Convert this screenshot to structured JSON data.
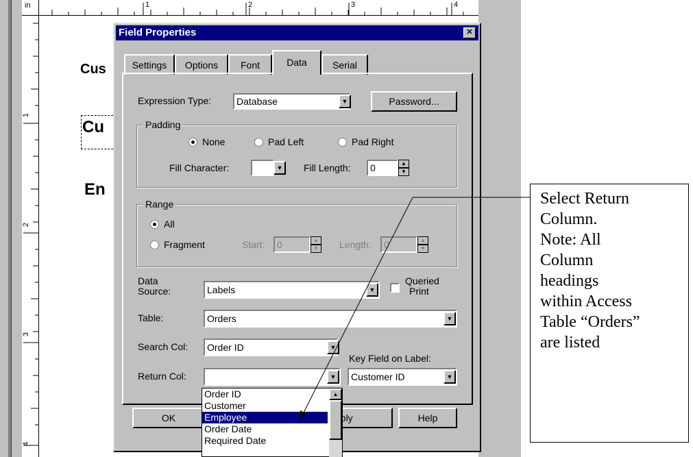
{
  "ruler": {
    "unit": "in",
    "marks": [
      "1",
      "2",
      "3",
      "4"
    ]
  },
  "label_preview": {
    "line1": "Cus",
    "line2": "Cu",
    "line3": "En"
  },
  "dialog": {
    "title": "Field Properties",
    "tabs": [
      "Settings",
      "Options",
      "Font",
      "Data",
      "Serial"
    ],
    "active_tab": "Data",
    "expression_type": {
      "label": "Expression Type:",
      "value": "Database"
    },
    "password_button": "Password...",
    "padding": {
      "label": "Padding",
      "options": [
        "None",
        "Pad Left",
        "Pad Right"
      ],
      "selected": "None",
      "fill_character_label": "Fill Character:",
      "fill_character_value": "",
      "fill_length_label": "Fill Length:",
      "fill_length_value": "0"
    },
    "range": {
      "label": "Range",
      "options": [
        "All",
        "Fragment"
      ],
      "selected": "All",
      "start_label": "Start:",
      "start_value": "0",
      "length_label": "Length:",
      "length_value": "0"
    },
    "data_source": {
      "label_line1": "Data",
      "label_line2": "Source:",
      "value": "Labels"
    },
    "queried_print": {
      "line1": "Queried",
      "line2": "Print",
      "checked": false
    },
    "table": {
      "label": "Table:",
      "value": "Orders"
    },
    "search_col": {
      "label": "Search Col:",
      "value": "Order ID"
    },
    "key_field": {
      "label": "Key Field on Label:",
      "value": "Customer ID"
    },
    "return_col": {
      "label": "Return Col:",
      "value": "",
      "options": [
        "Order ID",
        "Customer",
        "Employee",
        "Order Date",
        "Required Date"
      ],
      "highlighted": "Employee"
    },
    "buttons": {
      "ok": "OK",
      "apply": "pply",
      "help": "Help"
    }
  },
  "callout": {
    "lines": [
      "Select Return",
      "Column.",
      "Note: All",
      "Column",
      "headings",
      "within Access",
      "Table “Orders”",
      "are listed"
    ]
  }
}
